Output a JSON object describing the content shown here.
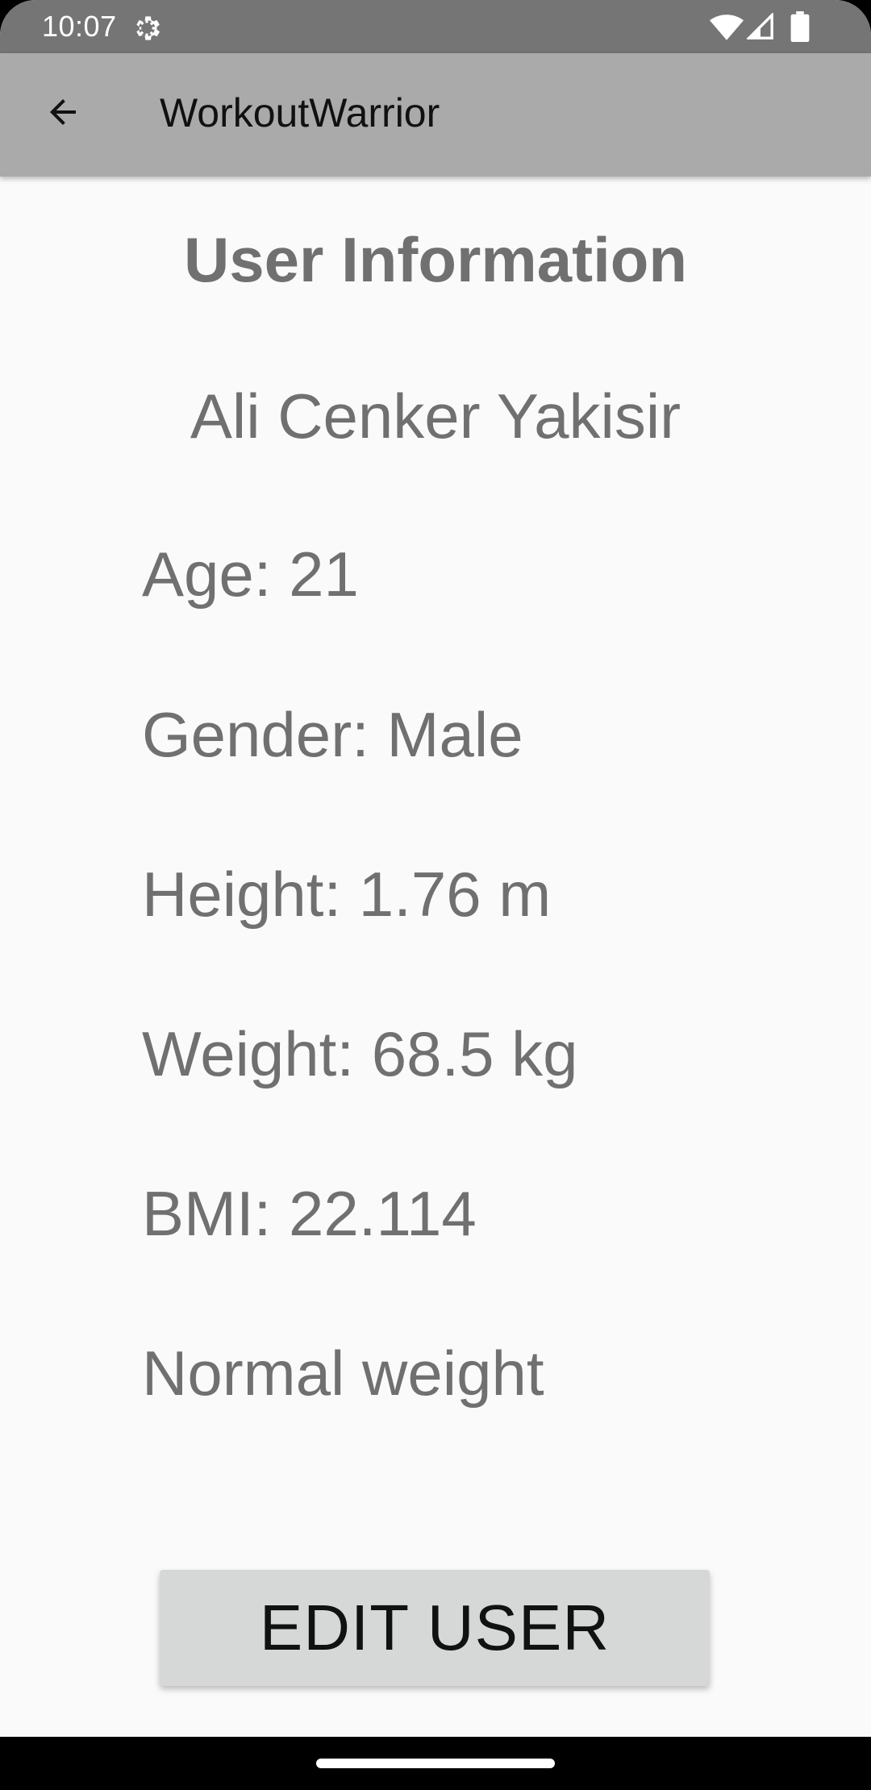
{
  "status_bar": {
    "time": "10:07",
    "icons": [
      "settings-gear-icon",
      "wifi-icon",
      "cell-signal-icon",
      "battery-icon"
    ]
  },
  "app_bar": {
    "title": "WorkoutWarrior",
    "back_icon": "arrow-back-icon"
  },
  "content": {
    "heading": "User Information",
    "name": "Ali Cenker Yakisir",
    "age": "Age: 21",
    "gender": "Gender: Male",
    "height": "Height: 1.76 m",
    "weight": "Weight: 68.5 kg",
    "bmi": "BMI: 22.114",
    "bmi_category": "Normal weight"
  },
  "actions": {
    "edit_label": "EDIT USER"
  },
  "colors": {
    "status_bar": "#757575",
    "app_bar": "#aaaaaa",
    "background": "#fafafa",
    "text": "#707070",
    "button": "#d6d7d7"
  }
}
